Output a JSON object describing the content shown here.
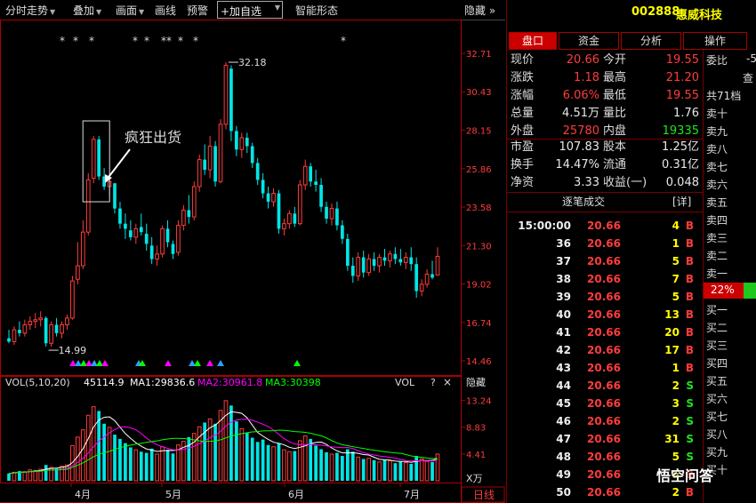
{
  "toolbar": {
    "timeshare": "分时走势",
    "overlay": "叠加",
    "canvas": "画面",
    "draw_line": "画线",
    "alert": "预警",
    "add_fav": "+加自选",
    "smart": "智能形态",
    "hide": "隐藏"
  },
  "stock": {
    "code": "002888",
    "name": "惠威科技"
  },
  "panel_tabs": [
    "盘口",
    "资金",
    "分析",
    "操作"
  ],
  "quote": [
    {
      "l1": "现价",
      "v1": "20.66",
      "l2": "今开",
      "v2": "19.55"
    },
    {
      "l1": "涨跌",
      "v1": "1.18",
      "l2": "最高",
      "v2": "21.20"
    },
    {
      "l1": "涨幅",
      "v1": "6.06%",
      "l2": "最低",
      "v2": "19.55"
    },
    {
      "l1": "总量",
      "v1": "4.51万",
      "l2": "量比",
      "v2": "1.76"
    },
    {
      "l1": "外盘",
      "v1": "25780",
      "l2": "内盘",
      "v2": "19335"
    }
  ],
  "fund": [
    {
      "l1": "市盈",
      "v1": "107.83",
      "l2": "股本",
      "v2": "1.25亿"
    },
    {
      "l1": "换手",
      "v1": "14.47%",
      "l2": "流通",
      "v2": "0.31亿"
    },
    {
      "l1": "净资",
      "v1": "3.33",
      "l2": "收益(一)",
      "v2": "0.048"
    }
  ],
  "ticks_header": {
    "title": "逐笔成交",
    "detail": "[详]"
  },
  "ticks": [
    {
      "t": "15:00:00",
      "p": "20.66",
      "v": "4",
      "s": "B"
    },
    {
      "t": "36",
      "p": "20.66",
      "v": "1",
      "s": "B"
    },
    {
      "t": "37",
      "p": "20.66",
      "v": "5",
      "s": "B"
    },
    {
      "t": "38",
      "p": "20.66",
      "v": "7",
      "s": "B"
    },
    {
      "t": "39",
      "p": "20.66",
      "v": "5",
      "s": "B"
    },
    {
      "t": "40",
      "p": "20.66",
      "v": "13",
      "s": "B"
    },
    {
      "t": "41",
      "p": "20.66",
      "v": "20",
      "s": "B"
    },
    {
      "t": "42",
      "p": "20.66",
      "v": "17",
      "s": "B"
    },
    {
      "t": "43",
      "p": "20.66",
      "v": "1",
      "s": "B"
    },
    {
      "t": "44",
      "p": "20.66",
      "v": "2",
      "s": "S"
    },
    {
      "t": "45",
      "p": "20.66",
      "v": "3",
      "s": "S"
    },
    {
      "t": "46",
      "p": "20.66",
      "v": "2",
      "s": "S"
    },
    {
      "t": "47",
      "p": "20.66",
      "v": "31",
      "s": "S"
    },
    {
      "t": "48",
      "p": "20.66",
      "v": "5",
      "s": "S"
    },
    {
      "t": "49",
      "p": "20.66",
      "v": "5",
      "s": "B"
    },
    {
      "t": "50",
      "p": "20.66",
      "v": "2",
      "s": "B"
    }
  ],
  "orderbook": {
    "weibi": "委比",
    "weibi_val": "-5",
    "query": "查",
    "total": "共71档",
    "sells": [
      "卖十",
      "卖九",
      "卖八",
      "卖七",
      "卖六",
      "卖五",
      "卖四",
      "卖三",
      "卖二",
      "卖一"
    ],
    "ratio": "22%",
    "buys": [
      "买一",
      "买二",
      "买三",
      "买四",
      "买五",
      "买六",
      "买七",
      "买八",
      "买九",
      "买十"
    ]
  },
  "watermark": "悟空问答",
  "chart_labels": {
    "annotation": "疯狂出货",
    "high_label": "32.18",
    "low_label": "14.99",
    "vol_title": "VOL(5,10,20)",
    "vol_value": "45114.9",
    "ma1": "MA1:29836.6",
    "ma2": "MA2:30961.8",
    "ma3": "MA3:30398",
    "vol_tag": "VOL",
    "help": "?",
    "close": "×",
    "hide": "隐藏",
    "unit": "X万",
    "period": "日线",
    "price_ticks": [
      "32.71",
      "30.43",
      "28.15",
      "25.86",
      "23.58",
      "21.30",
      "19.02",
      "16.74",
      "14.46"
    ],
    "vol_ticks": [
      "13.24",
      "8.83",
      "4.41"
    ],
    "months": [
      "4月",
      "5月",
      "6月",
      "7月"
    ]
  },
  "colors": {
    "up": "#ff3c3c",
    "down": "#00e6e6",
    "ma1": "#ffffff",
    "ma2": "#ff00ff",
    "ma3": "#00ff00"
  },
  "chart_data": {
    "type": "candlestick",
    "ylim": [
      14.46,
      32.71
    ],
    "candles": [
      [
        15.8,
        16.3,
        15.5,
        15.6
      ],
      [
        15.6,
        16.5,
        15.4,
        16.3
      ],
      [
        16.3,
        16.8,
        15.9,
        16.1
      ],
      [
        16.1,
        16.9,
        15.9,
        16.6
      ],
      [
        16.6,
        17.1,
        16.3,
        16.8
      ],
      [
        16.8,
        17.3,
        16.4,
        16.9
      ],
      [
        16.9,
        17.4,
        16.5,
        17.0
      ],
      [
        17.0,
        17.1,
        15.3,
        15.5
      ],
      [
        15.5,
        16.8,
        15.3,
        16.6
      ],
      [
        16.6,
        17.0,
        15.9,
        16.1
      ],
      [
        16.1,
        16.8,
        15.8,
        16.6
      ],
      [
        16.6,
        17.2,
        16.3,
        17.0
      ],
      [
        17.0,
        19.5,
        16.9,
        19.2
      ],
      [
        19.3,
        21.5,
        19.0,
        20.1
      ],
      [
        20.1,
        22.8,
        19.9,
        22.1
      ],
      [
        22.1,
        25.6,
        21.9,
        25.2
      ],
      [
        25.3,
        27.8,
        25.0,
        27.6
      ],
      [
        27.6,
        27.8,
        25.2,
        25.4
      ],
      [
        25.4,
        25.9,
        24.6,
        24.8
      ],
      [
        24.8,
        25.6,
        24.2,
        25.1
      ],
      [
        25.0,
        24.7,
        23.2,
        23.5
      ],
      [
        23.5,
        23.9,
        22.3,
        22.6
      ],
      [
        22.6,
        23.2,
        21.7,
        22.3
      ],
      [
        22.2,
        22.8,
        21.6,
        21.8
      ],
      [
        21.8,
        22.6,
        21.4,
        22.3
      ],
      [
        22.4,
        23.2,
        21.9,
        22.1
      ],
      [
        22.0,
        22.6,
        21.0,
        21.4
      ],
      [
        21.3,
        21.8,
        20.2,
        20.5
      ],
      [
        20.5,
        21.3,
        20.1,
        20.8
      ],
      [
        20.8,
        22.5,
        20.6,
        22.3
      ],
      [
        22.3,
        22.8,
        21.2,
        21.5
      ],
      [
        21.4,
        21.6,
        20.5,
        20.8
      ],
      [
        20.9,
        22.8,
        20.7,
        22.5
      ],
      [
        22.5,
        23.7,
        22.2,
        23.4
      ],
      [
        23.4,
        24.3,
        22.6,
        23.0
      ],
      [
        23.0,
        25.1,
        22.8,
        24.8
      ],
      [
        24.8,
        26.7,
        24.5,
        26.4
      ],
      [
        26.4,
        27.3,
        25.5,
        25.8
      ],
      [
        25.8,
        27.8,
        25.3,
        27.2
      ],
      [
        27.2,
        27.5,
        24.8,
        25.1
      ],
      [
        25.1,
        28.8,
        25.0,
        28.5
      ],
      [
        28.5,
        32.18,
        28.2,
        32.0
      ],
      [
        31.8,
        32.0,
        27.5,
        28.1
      ],
      [
        28.1,
        28.4,
        26.6,
        27.0
      ],
      [
        27.0,
        28.0,
        26.5,
        27.7
      ],
      [
        27.7,
        28.0,
        26.8,
        27.2
      ],
      [
        27.2,
        27.4,
        25.9,
        26.2
      ],
      [
        26.2,
        26.5,
        24.9,
        25.2
      ],
      [
        25.2,
        25.6,
        24.1,
        24.4
      ],
      [
        24.4,
        24.8,
        23.5,
        23.9
      ],
      [
        23.9,
        24.7,
        23.6,
        24.4
      ],
      [
        24.4,
        24.6,
        22.0,
        22.3
      ],
      [
        22.3,
        22.9,
        21.9,
        22.6
      ],
      [
        22.6,
        23.4,
        22.3,
        23.2
      ],
      [
        23.2,
        23.6,
        22.4,
        22.6
      ],
      [
        22.6,
        25.2,
        22.5,
        24.9
      ],
      [
        24.9,
        26.4,
        24.6,
        26.0
      ],
      [
        26.0,
        26.2,
        24.8,
        25.1
      ],
      [
        25.1,
        25.8,
        24.5,
        24.9
      ],
      [
        24.9,
        25.3,
        23.3,
        23.6
      ],
      [
        23.6,
        23.9,
        22.6,
        22.9
      ],
      [
        22.9,
        23.8,
        22.5,
        23.5
      ],
      [
        23.5,
        23.9,
        22.2,
        22.5
      ],
      [
        22.5,
        22.8,
        21.4,
        21.7
      ],
      [
        21.7,
        22.0,
        19.8,
        20.1
      ],
      [
        20.1,
        20.6,
        19.1,
        19.5
      ],
      [
        19.5,
        20.9,
        19.2,
        20.6
      ],
      [
        20.6,
        21.0,
        19.4,
        19.7
      ],
      [
        19.7,
        20.8,
        19.5,
        20.5
      ],
      [
        20.5,
        20.9,
        19.8,
        20.1
      ],
      [
        20.1,
        20.8,
        19.7,
        20.6
      ],
      [
        20.6,
        21.1,
        20.1,
        20.4
      ],
      [
        20.4,
        21.0,
        20.0,
        20.8
      ],
      [
        20.8,
        21.2,
        20.2,
        20.5
      ],
      [
        20.5,
        21.1,
        20.1,
        20.3
      ],
      [
        20.3,
        20.9,
        19.9,
        20.6
      ],
      [
        20.6,
        21.2,
        19.8,
        20.2
      ],
      [
        20.2,
        20.6,
        18.2,
        18.6
      ],
      [
        18.6,
        19.3,
        18.3,
        19.0
      ],
      [
        19.0,
        19.9,
        18.8,
        19.6
      ],
      [
        19.6,
        20.4,
        19.3,
        19.4
      ],
      [
        19.55,
        21.2,
        19.55,
        20.66
      ]
    ],
    "volume": [
      1.2,
      1.4,
      1.6,
      1.5,
      1.8,
      1.7,
      1.9,
      2.6,
      2.2,
      2.0,
      2.4,
      2.6,
      5.8,
      7.2,
      8.4,
      10.8,
      12.2,
      11.5,
      9.4,
      8.8,
      7.6,
      6.9,
      6.2,
      5.5,
      5.1,
      4.8,
      4.6,
      5.3,
      4.4,
      5.6,
      5.1,
      4.5,
      5.9,
      6.5,
      7.2,
      7.8,
      8.9,
      9.6,
      10.2,
      9.4,
      11.6,
      13.2,
      12.4,
      9.8,
      8.6,
      7.9,
      7.1,
      6.4,
      6.8,
      5.9,
      5.6,
      6.2,
      5.1,
      4.8,
      4.9,
      6.6,
      7.4,
      6.9,
      5.8,
      5.2,
      4.7,
      4.4,
      4.6,
      4.1,
      5.2,
      4.8,
      3.9,
      3.6,
      3.7,
      3.4,
      3.1,
      3.5,
      3.3,
      2.9,
      3.2,
      3.0,
      2.8,
      4.1,
      3.6,
      3.2,
      3.1,
      4.4
    ]
  }
}
